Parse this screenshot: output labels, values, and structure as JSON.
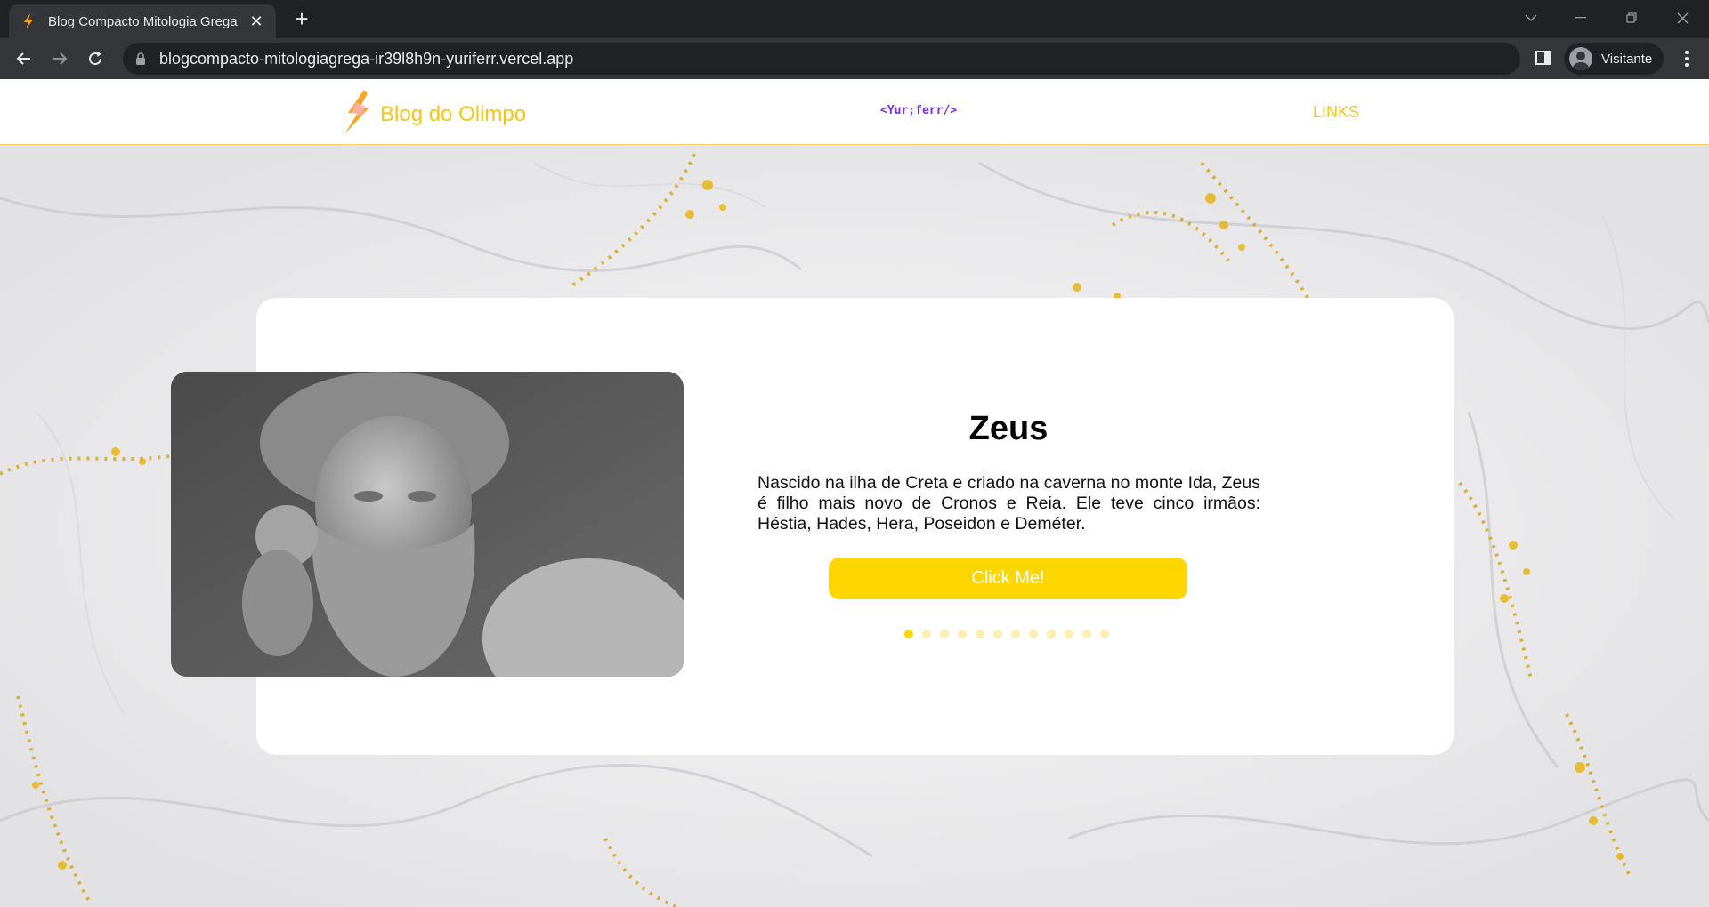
{
  "browser": {
    "tab_title": "Blog Compacto Mitologia Grega",
    "url": "blogcompacto-mitologiagrega-ir39l8h9n-yuriferr.vercel.app",
    "profile_name": "Visitante",
    "icons": [
      "back-icon",
      "forward-icon",
      "reload-icon",
      "lock-icon",
      "side-panel-icon",
      "profile-avatar",
      "menu-icon"
    ]
  },
  "header": {
    "brand_title": "Blog do Olimpo",
    "dev_logo": "<Yur;ferr/>",
    "links_label": "LINKS"
  },
  "slide": {
    "title": "Zeus",
    "text": "Nascido na ilha de Creta e criado na caverna no monte Ida, Zeus é filho mais novo de Cronos e Reia. Ele teve cinco irmãos: Héstia, Hades, Hera, Poseidon e Deméter.",
    "button_label": "Click Me!",
    "dots_total": 12,
    "active_dot": 1
  },
  "colors": {
    "accent": "#ffd700",
    "brand": "#f5c518",
    "dev_logo": "#7b2fe0"
  }
}
